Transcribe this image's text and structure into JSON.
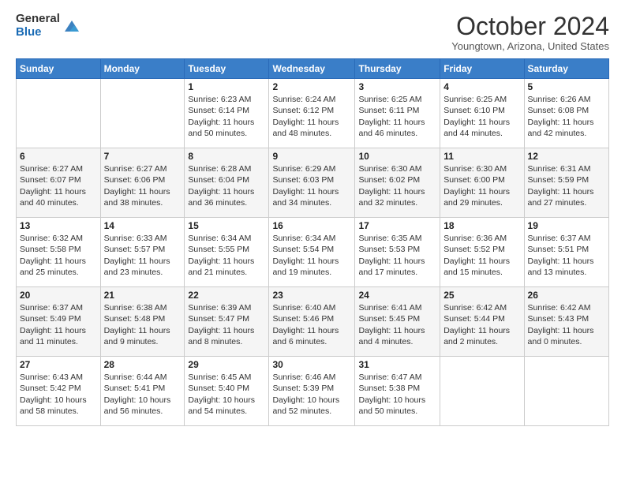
{
  "logo": {
    "general": "General",
    "blue": "Blue"
  },
  "title": "October 2024",
  "location": "Youngtown, Arizona, United States",
  "days_of_week": [
    "Sunday",
    "Monday",
    "Tuesday",
    "Wednesday",
    "Thursday",
    "Friday",
    "Saturday"
  ],
  "weeks": [
    [
      {
        "day": "",
        "info": ""
      },
      {
        "day": "",
        "info": ""
      },
      {
        "day": "1",
        "info": "Sunrise: 6:23 AM\nSunset: 6:14 PM\nDaylight: 11 hours and 50 minutes."
      },
      {
        "day": "2",
        "info": "Sunrise: 6:24 AM\nSunset: 6:12 PM\nDaylight: 11 hours and 48 minutes."
      },
      {
        "day": "3",
        "info": "Sunrise: 6:25 AM\nSunset: 6:11 PM\nDaylight: 11 hours and 46 minutes."
      },
      {
        "day": "4",
        "info": "Sunrise: 6:25 AM\nSunset: 6:10 PM\nDaylight: 11 hours and 44 minutes."
      },
      {
        "day": "5",
        "info": "Sunrise: 6:26 AM\nSunset: 6:08 PM\nDaylight: 11 hours and 42 minutes."
      }
    ],
    [
      {
        "day": "6",
        "info": "Sunrise: 6:27 AM\nSunset: 6:07 PM\nDaylight: 11 hours and 40 minutes."
      },
      {
        "day": "7",
        "info": "Sunrise: 6:27 AM\nSunset: 6:06 PM\nDaylight: 11 hours and 38 minutes."
      },
      {
        "day": "8",
        "info": "Sunrise: 6:28 AM\nSunset: 6:04 PM\nDaylight: 11 hours and 36 minutes."
      },
      {
        "day": "9",
        "info": "Sunrise: 6:29 AM\nSunset: 6:03 PM\nDaylight: 11 hours and 34 minutes."
      },
      {
        "day": "10",
        "info": "Sunrise: 6:30 AM\nSunset: 6:02 PM\nDaylight: 11 hours and 32 minutes."
      },
      {
        "day": "11",
        "info": "Sunrise: 6:30 AM\nSunset: 6:00 PM\nDaylight: 11 hours and 29 minutes."
      },
      {
        "day": "12",
        "info": "Sunrise: 6:31 AM\nSunset: 5:59 PM\nDaylight: 11 hours and 27 minutes."
      }
    ],
    [
      {
        "day": "13",
        "info": "Sunrise: 6:32 AM\nSunset: 5:58 PM\nDaylight: 11 hours and 25 minutes."
      },
      {
        "day": "14",
        "info": "Sunrise: 6:33 AM\nSunset: 5:57 PM\nDaylight: 11 hours and 23 minutes."
      },
      {
        "day": "15",
        "info": "Sunrise: 6:34 AM\nSunset: 5:55 PM\nDaylight: 11 hours and 21 minutes."
      },
      {
        "day": "16",
        "info": "Sunrise: 6:34 AM\nSunset: 5:54 PM\nDaylight: 11 hours and 19 minutes."
      },
      {
        "day": "17",
        "info": "Sunrise: 6:35 AM\nSunset: 5:53 PM\nDaylight: 11 hours and 17 minutes."
      },
      {
        "day": "18",
        "info": "Sunrise: 6:36 AM\nSunset: 5:52 PM\nDaylight: 11 hours and 15 minutes."
      },
      {
        "day": "19",
        "info": "Sunrise: 6:37 AM\nSunset: 5:51 PM\nDaylight: 11 hours and 13 minutes."
      }
    ],
    [
      {
        "day": "20",
        "info": "Sunrise: 6:37 AM\nSunset: 5:49 PM\nDaylight: 11 hours and 11 minutes."
      },
      {
        "day": "21",
        "info": "Sunrise: 6:38 AM\nSunset: 5:48 PM\nDaylight: 11 hours and 9 minutes."
      },
      {
        "day": "22",
        "info": "Sunrise: 6:39 AM\nSunset: 5:47 PM\nDaylight: 11 hours and 8 minutes."
      },
      {
        "day": "23",
        "info": "Sunrise: 6:40 AM\nSunset: 5:46 PM\nDaylight: 11 hours and 6 minutes."
      },
      {
        "day": "24",
        "info": "Sunrise: 6:41 AM\nSunset: 5:45 PM\nDaylight: 11 hours and 4 minutes."
      },
      {
        "day": "25",
        "info": "Sunrise: 6:42 AM\nSunset: 5:44 PM\nDaylight: 11 hours and 2 minutes."
      },
      {
        "day": "26",
        "info": "Sunrise: 6:42 AM\nSunset: 5:43 PM\nDaylight: 11 hours and 0 minutes."
      }
    ],
    [
      {
        "day": "27",
        "info": "Sunrise: 6:43 AM\nSunset: 5:42 PM\nDaylight: 10 hours and 58 minutes."
      },
      {
        "day": "28",
        "info": "Sunrise: 6:44 AM\nSunset: 5:41 PM\nDaylight: 10 hours and 56 minutes."
      },
      {
        "day": "29",
        "info": "Sunrise: 6:45 AM\nSunset: 5:40 PM\nDaylight: 10 hours and 54 minutes."
      },
      {
        "day": "30",
        "info": "Sunrise: 6:46 AM\nSunset: 5:39 PM\nDaylight: 10 hours and 52 minutes."
      },
      {
        "day": "31",
        "info": "Sunrise: 6:47 AM\nSunset: 5:38 PM\nDaylight: 10 hours and 50 minutes."
      },
      {
        "day": "",
        "info": ""
      },
      {
        "day": "",
        "info": ""
      }
    ]
  ]
}
